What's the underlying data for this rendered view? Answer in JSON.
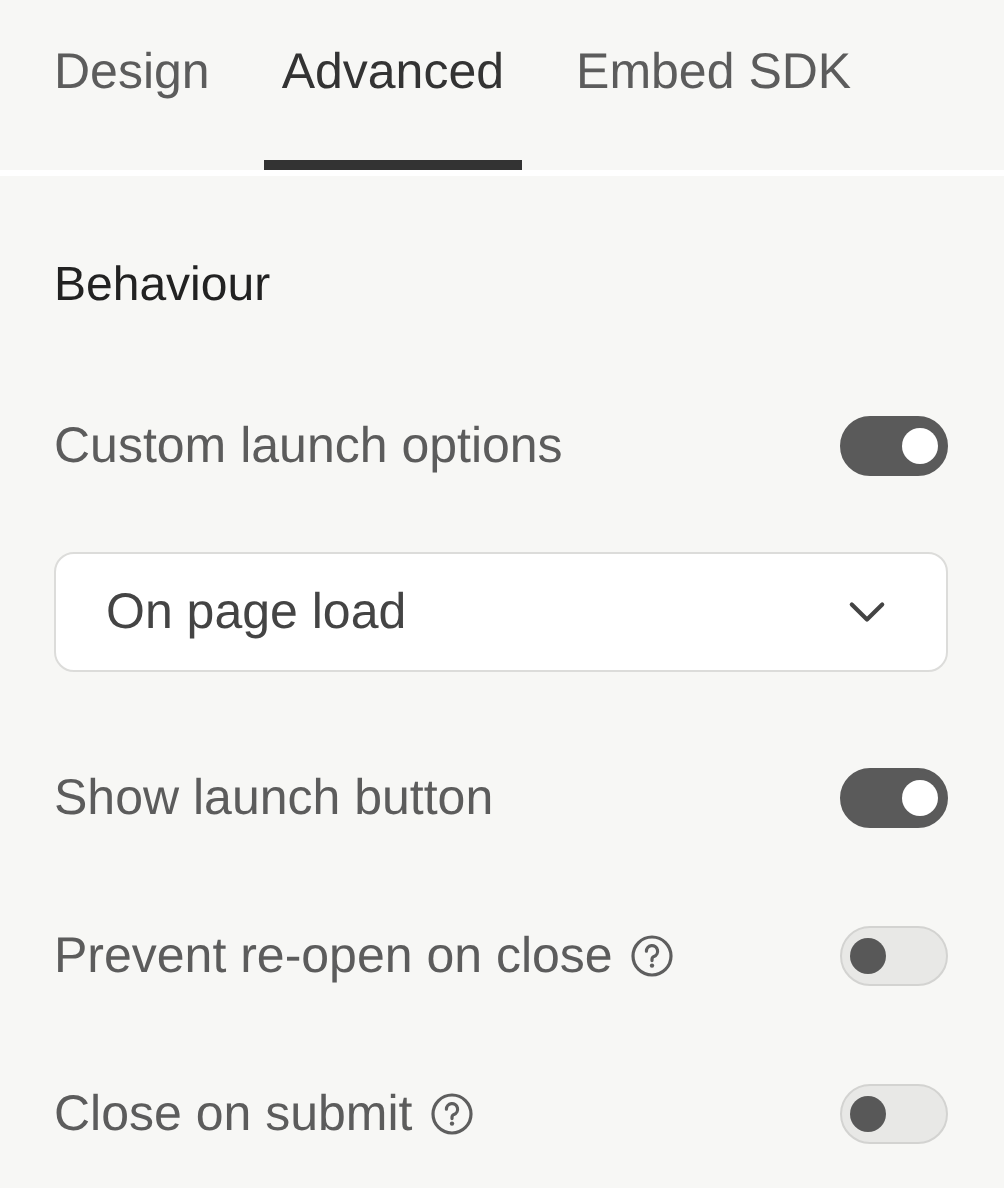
{
  "tabs": [
    {
      "label": "Design",
      "selected": false
    },
    {
      "label": "Advanced",
      "selected": true
    },
    {
      "label": "Embed SDK",
      "selected": false
    }
  ],
  "section": {
    "title": "Behaviour"
  },
  "settings": [
    {
      "kind": "toggle",
      "label": "Custom launch options",
      "help": false,
      "on": true
    },
    {
      "kind": "select",
      "value": "On page load"
    },
    {
      "kind": "toggle",
      "label": "Show launch button",
      "help": false,
      "on": true
    },
    {
      "kind": "toggle",
      "label": "Prevent re-open on close",
      "help": true,
      "on": false
    },
    {
      "kind": "toggle",
      "label": "Close on submit",
      "help": true,
      "on": false
    }
  ]
}
